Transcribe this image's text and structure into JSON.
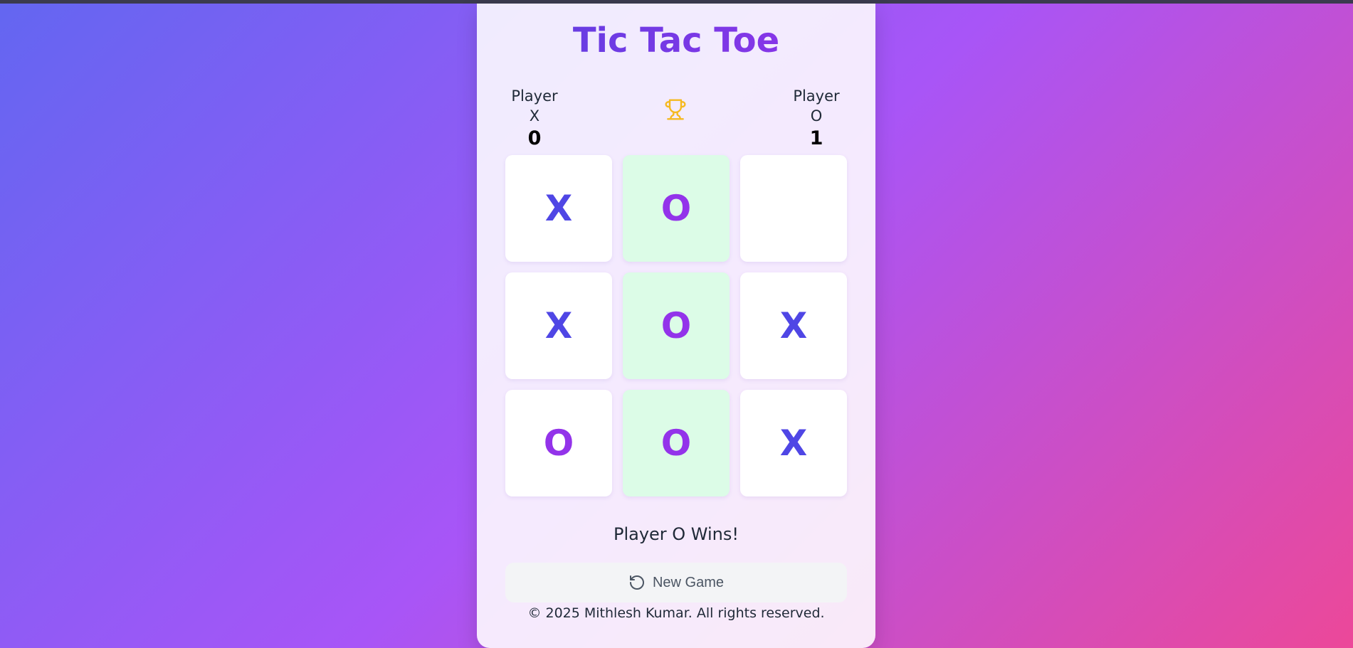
{
  "game": {
    "title": "Tic Tac Toe",
    "status": "Player O Wins!",
    "new_game_label": "New Game",
    "footer": "© 2025 Mithlesh Kumar. All rights reserved.",
    "trophy_icon": "trophy-icon",
    "reset_icon": "rotate-ccw-icon"
  },
  "players": {
    "x": {
      "name": "Player X",
      "score": "0"
    },
    "o": {
      "name": "Player O",
      "score": "1"
    }
  },
  "board": [
    "X",
    "O",
    "",
    "X",
    "O",
    "X",
    "O",
    "O",
    "X"
  ],
  "winning_cells": [
    1,
    4,
    7
  ],
  "colors": {
    "x_mark": "#4f46e5",
    "o_mark": "#9333ea",
    "win_highlight": "#dcfce7",
    "trophy": "#f5b921"
  }
}
